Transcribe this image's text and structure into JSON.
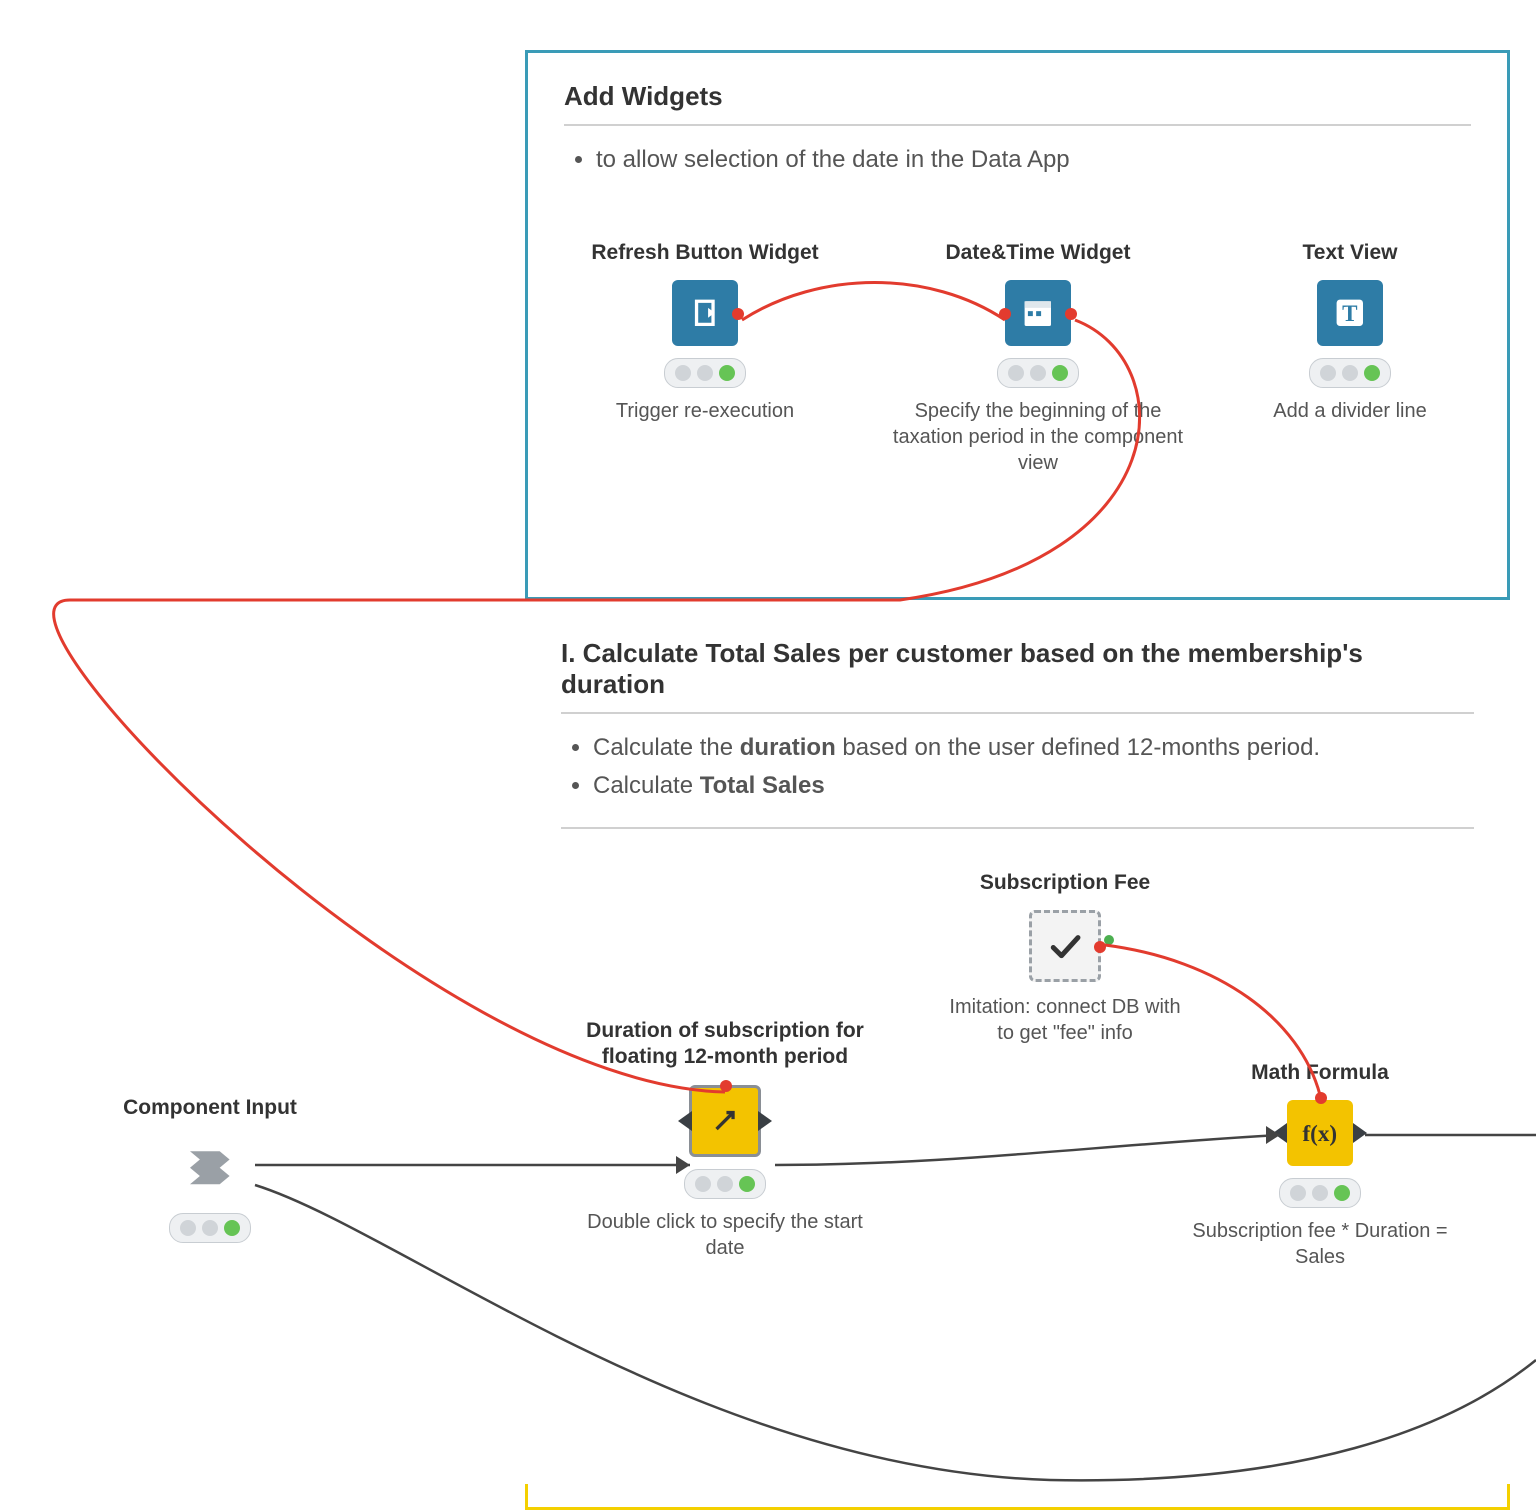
{
  "annotations": {
    "add_widgets": {
      "title": "Add Widgets",
      "bullets": [
        "to allow selection of the date in the Data App"
      ]
    },
    "calc_sales": {
      "title": "I. Calculate Total Sales per customer based on the membership's duration",
      "bullets_html": [
        "Calculate the <b>duration</b> based on the user defined 12-months period.",
        "Calculate <b>Total Sales</b>"
      ]
    }
  },
  "nodes": {
    "refresh_btn": {
      "label": "Refresh Button Widget",
      "desc": "Trigger re-execution"
    },
    "datetime": {
      "label": "Date&Time Widget",
      "desc": "Specify the beginning of the taxation period in the component view"
    },
    "text_view": {
      "label": "Text View",
      "desc": "Add a divider line"
    },
    "comp_input": {
      "label": "Component Input",
      "desc": ""
    },
    "duration": {
      "label": "Duration of subscription for floating 12-month period",
      "desc": "Double click to specify the start date"
    },
    "sub_fee": {
      "label": "Subscription Fee",
      "desc": "Imitation: connect DB with to get \"fee\" info"
    },
    "math": {
      "label": "Math Formula",
      "desc": "Subscription fee * Duration = Sales"
    }
  }
}
